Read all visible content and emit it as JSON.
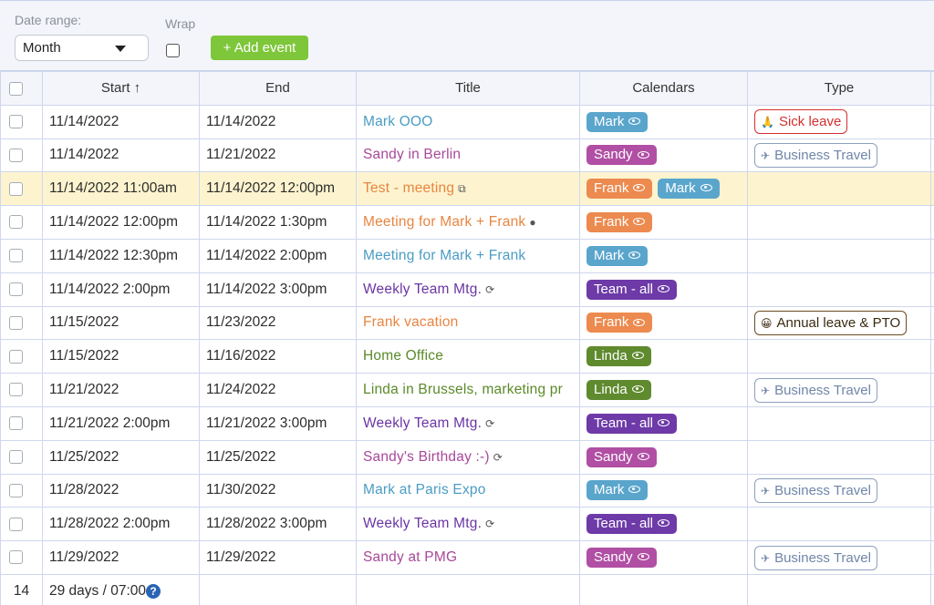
{
  "toolbar": {
    "date_range_label": "Date range:",
    "date_range_value": "Month",
    "wrap_label": "Wrap",
    "add_event_label": "+ Add event"
  },
  "columns": {
    "start": "Start ↑",
    "end": "End",
    "title": "Title",
    "calendars": "Calendars",
    "type": "Type"
  },
  "colors": {
    "Mark": "#5aa5cc",
    "Sandy": "#b04fa4",
    "Frank": "#ec8a4f",
    "Team - all": "#6d3aa8",
    "Linda": "#5f8a2e"
  },
  "rows": [
    {
      "start": "11/14/2022",
      "end": "11/14/2022",
      "title": "Mark OOO",
      "title_color": "#4a9cc4",
      "title_icon": "",
      "calendars": [
        "Mark"
      ],
      "type": "Sick leave",
      "type_style": "sick",
      "type_icon": "🙏",
      "highlight": false
    },
    {
      "start": "11/14/2022",
      "end": "11/21/2022",
      "title": "Sandy in Berlin",
      "title_color": "#a8489a",
      "title_icon": "",
      "calendars": [
        "Sandy"
      ],
      "type": "Business Travel",
      "type_style": "travel",
      "type_icon": "✈",
      "highlight": false
    },
    {
      "start": "11/14/2022 11:00am",
      "end": "11/14/2022 12:00pm",
      "title": "Test - meeting",
      "title_color": "#e88540",
      "title_icon": "⧉",
      "calendars": [
        "Frank",
        "Mark"
      ],
      "type": "",
      "type_style": "",
      "type_icon": "",
      "highlight": true
    },
    {
      "start": "11/14/2022 12:00pm",
      "end": "11/14/2022 1:30pm",
      "title": "Meeting for Mark + Frank",
      "title_color": "#e88540",
      "title_icon": "●",
      "calendars": [
        "Frank"
      ],
      "type": "",
      "type_style": "",
      "type_icon": "",
      "highlight": false
    },
    {
      "start": "11/14/2022 12:30pm",
      "end": "11/14/2022 2:00pm",
      "title": "Meeting for Mark + Frank",
      "title_color": "#4a9cc4",
      "title_icon": "",
      "calendars": [
        "Mark"
      ],
      "type": "",
      "type_style": "",
      "type_icon": "",
      "highlight": false
    },
    {
      "start": "11/14/2022 2:00pm",
      "end": "11/14/2022 3:00pm",
      "title": "Weekly Team Mtg.",
      "title_color": "#6a35a4",
      "title_icon": "⟳",
      "calendars": [
        "Team - all"
      ],
      "type": "",
      "type_style": "",
      "type_icon": "",
      "highlight": false
    },
    {
      "start": "11/15/2022",
      "end": "11/23/2022",
      "title": "Frank vacation",
      "title_color": "#e88540",
      "title_icon": "",
      "calendars": [
        "Frank"
      ],
      "type": "Annual leave & PTO",
      "type_style": "annual",
      "type_icon": "😀",
      "highlight": false
    },
    {
      "start": "11/15/2022",
      "end": "11/16/2022",
      "title": "Home Office",
      "title_color": "#5a8a28",
      "title_icon": "",
      "calendars": [
        "Linda"
      ],
      "type": "",
      "type_style": "",
      "type_icon": "",
      "highlight": false
    },
    {
      "start": "11/21/2022",
      "end": "11/24/2022",
      "title": "Linda in Brussels, marketing pr",
      "title_color": "#5a8a28",
      "title_icon": "",
      "calendars": [
        "Linda"
      ],
      "type": "Business Travel",
      "type_style": "travel",
      "type_icon": "✈",
      "highlight": false
    },
    {
      "start": "11/21/2022 2:00pm",
      "end": "11/21/2022 3:00pm",
      "title": "Weekly Team Mtg.",
      "title_color": "#6a35a4",
      "title_icon": "⟳",
      "calendars": [
        "Team - all"
      ],
      "type": "",
      "type_style": "",
      "type_icon": "",
      "highlight": false
    },
    {
      "start": "11/25/2022",
      "end": "11/25/2022",
      "title": "Sandy's Birthday :-)",
      "title_color": "#a8489a",
      "title_icon": "⟳",
      "calendars": [
        "Sandy"
      ],
      "type": "",
      "type_style": "",
      "type_icon": "",
      "highlight": false
    },
    {
      "start": "11/28/2022",
      "end": "11/30/2022",
      "title": "Mark at Paris Expo",
      "title_color": "#4a9cc4",
      "title_icon": "",
      "calendars": [
        "Mark"
      ],
      "type": "Business Travel",
      "type_style": "travel",
      "type_icon": "✈",
      "highlight": false
    },
    {
      "start": "11/28/2022 2:00pm",
      "end": "11/28/2022 3:00pm",
      "title": "Weekly Team Mtg.",
      "title_color": "#6a35a4",
      "title_icon": "⟳",
      "calendars": [
        "Team - all"
      ],
      "type": "",
      "type_style": "",
      "type_icon": "",
      "highlight": false
    },
    {
      "start": "11/29/2022",
      "end": "11/29/2022",
      "title": "Sandy at PMG",
      "title_color": "#a8489a",
      "title_icon": "",
      "calendars": [
        "Sandy"
      ],
      "type": "Business Travel",
      "type_style": "travel",
      "type_icon": "✈",
      "highlight": false
    }
  ],
  "footer": {
    "count": "14",
    "summary": "29 days / 07:00",
    "help_icon": "?"
  }
}
